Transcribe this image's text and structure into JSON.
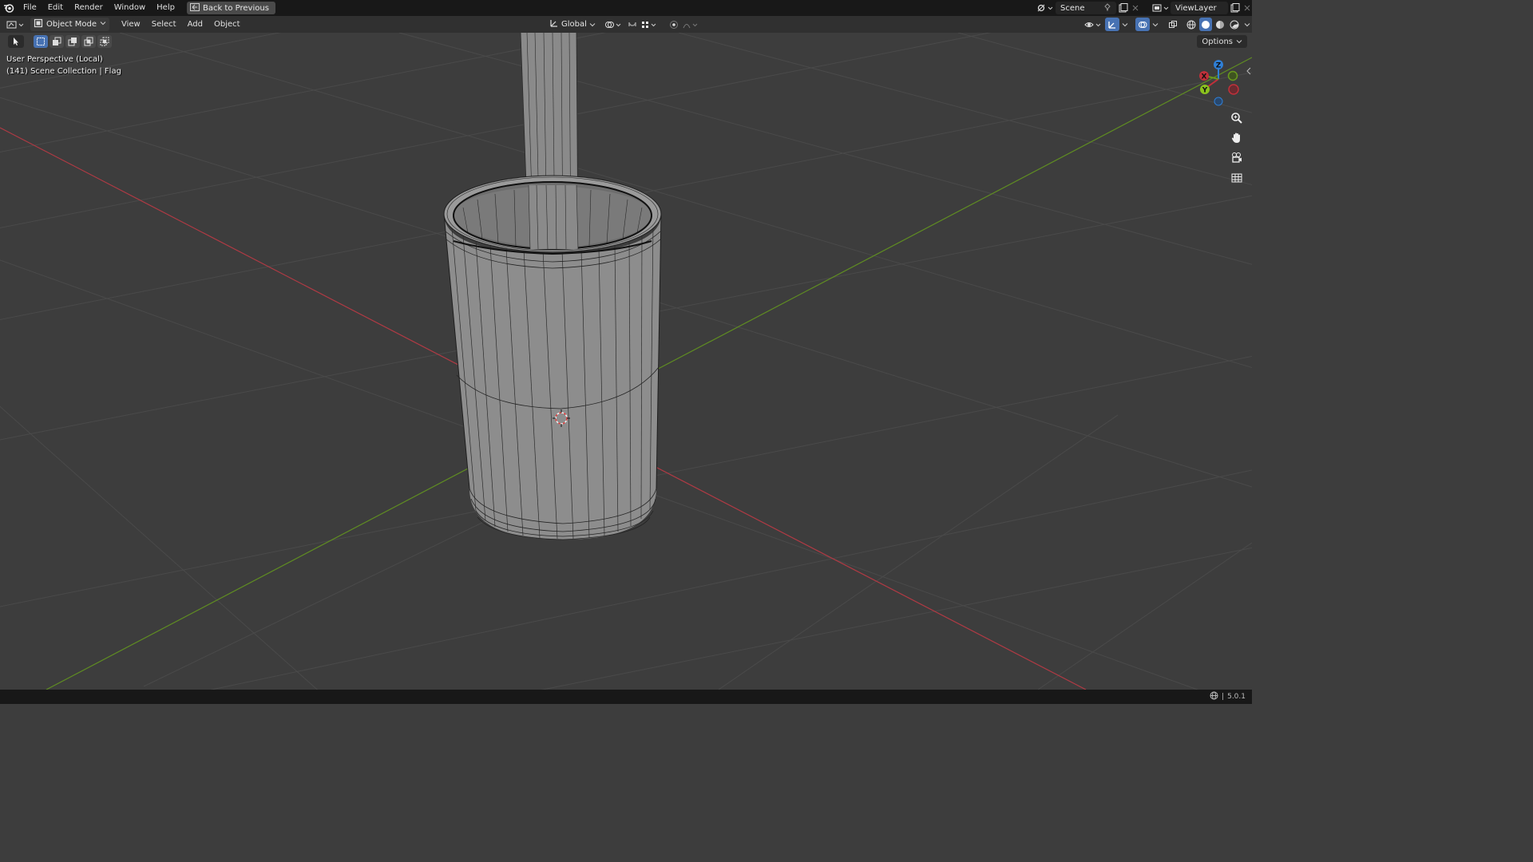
{
  "menu": {
    "items": [
      "File",
      "Edit",
      "Render",
      "Window",
      "Help"
    ],
    "back_label": "Back to Previous"
  },
  "topright": {
    "scene_label": "Scene",
    "viewlayer_label": "ViewLayer"
  },
  "header": {
    "mode_label": "Object Mode",
    "menus": [
      "View",
      "Select",
      "Add",
      "Object"
    ],
    "orientation_label": "Global"
  },
  "viewport": {
    "perspective_label": "User Perspective (Local)",
    "collection_label": "(141) Scene Collection | Flag",
    "options_label": "Options",
    "gizmo": {
      "x_label": "X",
      "y_label": "Y",
      "z_label": "Z"
    }
  },
  "status": {
    "version": "5.0.1"
  },
  "colors": {
    "x_axis": "#c0303a",
    "y_axis": "#6a9a1e",
    "z_axis": "#2f7fd6",
    "accent": "#4772b3",
    "viewport_bg": "#3d3d3d"
  },
  "icons": [
    "blender-logo-icon",
    "back-icon",
    "editor-type-icon",
    "object-mode-icon",
    "transform-orientation-icon",
    "pivot-icon",
    "snap-icon",
    "snap-increment-icon",
    "proportional-edit-icon",
    "select-box-icon",
    "selection-mode-icons",
    "visibility-icon",
    "gizmo-icon",
    "overlay-icon",
    "xray-icon",
    "shading-wireframe-icon",
    "shading-solid-icon",
    "shading-material-icon",
    "shading-rendered-icon",
    "zoom-icon",
    "hand-icon",
    "camera-icon",
    "grid-icon",
    "pin-icon",
    "new-scene-icon",
    "globe-icon"
  ]
}
